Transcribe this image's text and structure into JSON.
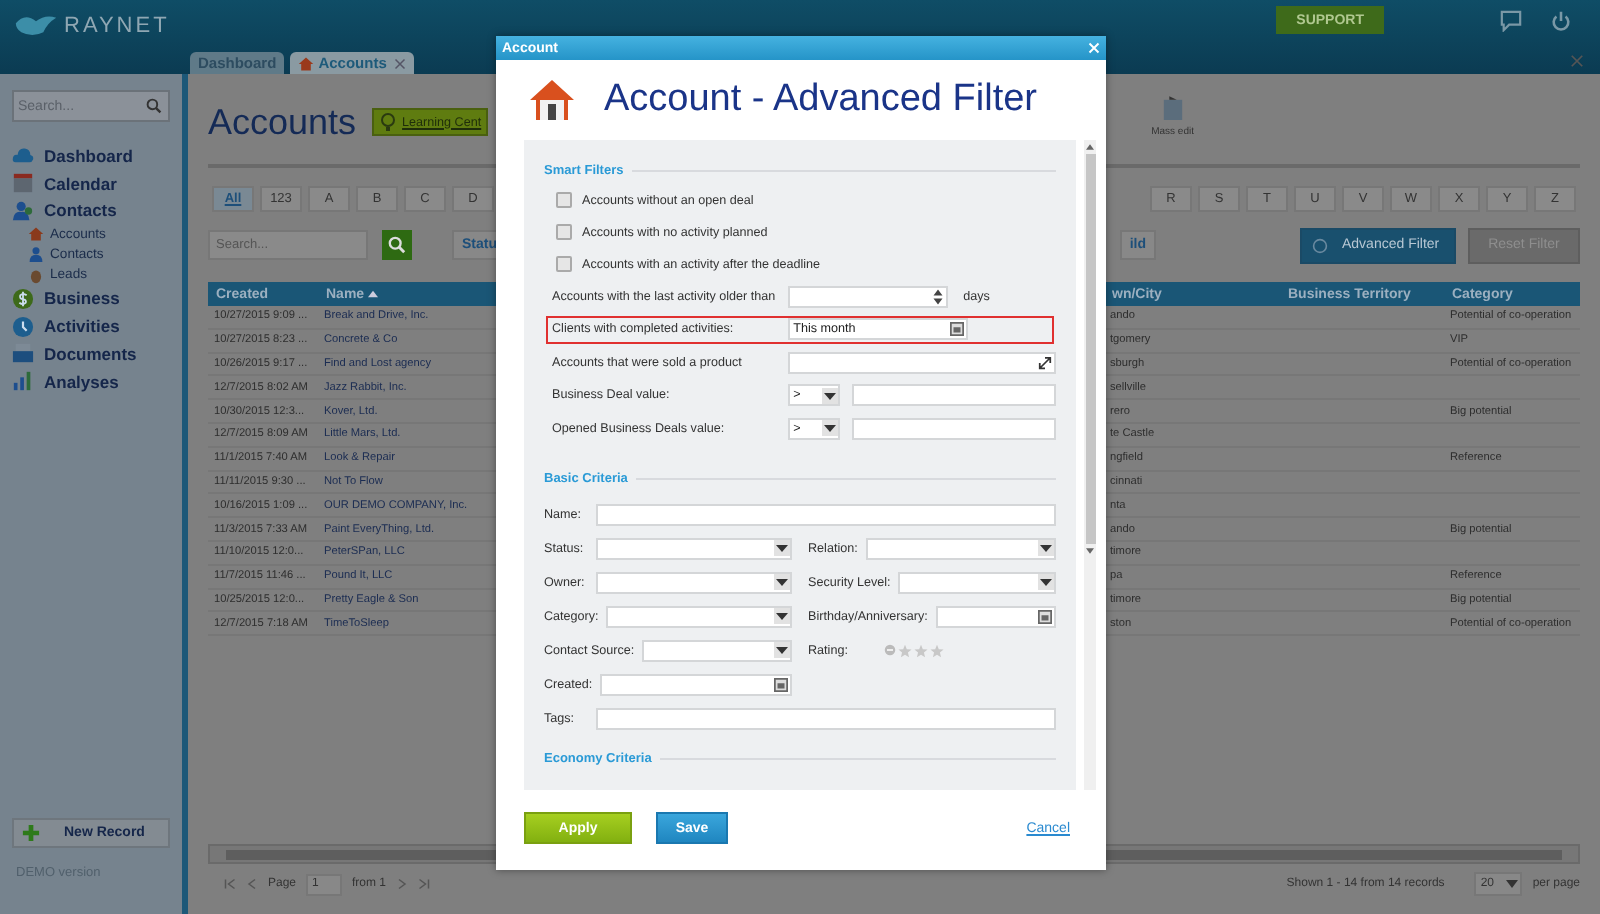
{
  "header": {
    "logo": "RAYNET",
    "support_button": "SUPPORT"
  },
  "tabs": [
    {
      "label": "Dashboard",
      "selected": false,
      "closable": false
    },
    {
      "label": "Accounts",
      "selected": true,
      "closable": true
    }
  ],
  "sidebar": {
    "search_placeholder": "Search...",
    "nav": [
      {
        "label": "Dashboard",
        "kind": "cloud"
      },
      {
        "label": "Calendar",
        "kind": "calendar"
      },
      {
        "label": "Contacts",
        "kind": "people",
        "children": [
          {
            "label": "Accounts",
            "kind": "house"
          },
          {
            "label": "Contacts",
            "kind": "person"
          },
          {
            "label": "Leads",
            "kind": "egg"
          }
        ]
      },
      {
        "label": "Business",
        "kind": "dollar"
      },
      {
        "label": "Activities",
        "kind": "clock"
      },
      {
        "label": "Documents",
        "kind": "tray"
      },
      {
        "label": "Analyses",
        "kind": "chart"
      }
    ],
    "new_record": "New Record",
    "footer": "DEMO version"
  },
  "main": {
    "title": "Accounts",
    "learning_center": "Learning Cent",
    "mass_edit": "Mass edit",
    "letters_left": [
      {
        "label": "All",
        "selected": true
      },
      {
        "label": "123",
        "selected": false
      },
      {
        "label": "A",
        "selected": false
      },
      {
        "label": "B",
        "selected": false
      },
      {
        "label": "C",
        "selected": false
      },
      {
        "label": "D",
        "selected": false
      }
    ],
    "letters_right": [
      {
        "label": "R",
        "selected": false
      },
      {
        "label": "S",
        "selected": false
      },
      {
        "label": "T",
        "selected": false
      },
      {
        "label": "U",
        "selected": false
      },
      {
        "label": "V",
        "selected": false
      },
      {
        "label": "W",
        "selected": false
      },
      {
        "label": "X",
        "selected": false
      },
      {
        "label": "Y",
        "selected": false
      },
      {
        "label": "Z",
        "selected": false
      }
    ],
    "search_placeholder": "Search...",
    "status_button": "Statu",
    "cut_button": "ild",
    "advanced_filter": "Advanced Filter",
    "reset_filter": "Reset Filter"
  },
  "table": {
    "columns": [
      "Created",
      "Name",
      "wn/City",
      "Business Territory",
      "Category"
    ],
    "rows": [
      {
        "created": "10/27/2015 9:09 ...",
        "name": "Break and Drive, Inc.",
        "town": "ando",
        "category": "Potential of co-operation"
      },
      {
        "created": "10/27/2015 8:23 ...",
        "name": "Concrete & Co",
        "town": "tgomery",
        "category": "VIP"
      },
      {
        "created": "10/26/2015 9:17 ...",
        "name": "Find and Lost agency",
        "town": "sburgh",
        "category": "Potential of co-operation"
      },
      {
        "created": "12/7/2015 8:02 AM",
        "name": "Jazz Rabbit, Inc.",
        "town": "sellville"
      },
      {
        "created": "10/30/2015 12:3...",
        "name": "Kover, Ltd.",
        "town": "rero",
        "category": "Big potential"
      },
      {
        "created": "12/7/2015 8:09 AM",
        "name": "Little Mars, Ltd.",
        "town": "te Castle"
      },
      {
        "created": "11/1/2015 7:40 AM",
        "name": "Look & Repair",
        "town": "ngfield",
        "category": "Reference"
      },
      {
        "created": "11/11/2015 9:30 ...",
        "name": "Not To Flow",
        "town": "cinnati"
      },
      {
        "created": "10/16/2015 1:09 ...",
        "name": "OUR DEMO COMPANY, Inc.",
        "town": "nta"
      },
      {
        "created": "11/3/2015 7:33 AM",
        "name": "Paint EveryThing, Ltd.",
        "town": "ando",
        "category": "Big potential"
      },
      {
        "created": "11/10/2015 12:0...",
        "name": "PeterSPan, LLC",
        "town": "timore"
      },
      {
        "created": "11/7/2015 11:46 ...",
        "name": "Pound It, LLC",
        "town": "pa",
        "category": "Reference"
      },
      {
        "created": "10/25/2015 12:0...",
        "name": "Pretty Eagle & Son",
        "town": "timore",
        "category": "Big potential"
      },
      {
        "created": "12/7/2015 7:18 AM",
        "name": "TimeToSleep",
        "town": "ston",
        "category": "Potential of co-operation"
      }
    ]
  },
  "pagination": {
    "page_label": "Page",
    "page": "1",
    "from": "from 1",
    "shown": "Shown 1 - 14 from 14 records",
    "per_page_value": "20",
    "per_page": "per page"
  },
  "modal": {
    "title": "Account",
    "heading": "Account - Advanced Filter",
    "smart_title": "Smart Filters",
    "checks": [
      {
        "label": "Accounts without an open deal",
        "checked": false
      },
      {
        "label": "Accounts with no activity planned",
        "checked": false
      },
      {
        "label": "Accounts with an activity after the deadline",
        "checked": false
      }
    ],
    "rows": [
      {
        "kind": "spinner",
        "label": "Accounts with the last activity older than",
        "suffix": "days",
        "highlighted": false
      },
      {
        "kind": "date",
        "label": "Clients with completed activities:",
        "value": "This month",
        "highlighted": true
      },
      {
        "kind": "picker",
        "label": "Accounts that were sold a product",
        "highlighted": false
      },
      {
        "kind": "compare",
        "label": "Business Deal value:",
        "operator": ">",
        "highlighted": false
      },
      {
        "kind": "compare",
        "label": "Opened Business Deals value:",
        "operator": ">",
        "highlighted": false
      }
    ],
    "basic_title": "Basic Criteria",
    "fields": [
      {
        "kind": "wide",
        "label": "Name:"
      },
      {
        "kind": "select",
        "label": "Status:"
      },
      {
        "kind": "select",
        "label": "Relation:"
      },
      {
        "kind": "select",
        "label": "Owner:"
      },
      {
        "kind": "select",
        "label": "Security Level:"
      },
      {
        "kind": "select",
        "label": "Category:"
      },
      {
        "kind": "date",
        "label": "Birthday/Anniversary:"
      },
      {
        "kind": "select",
        "label": "Contact Source:"
      },
      {
        "kind": "rating",
        "label": "Rating:",
        "stars": 0
      },
      {
        "kind": "date",
        "label": "Created:"
      },
      {
        "kind": "wide",
        "label": "Tags:"
      }
    ],
    "economy_title": "Economy Criteria",
    "apply": "Apply",
    "save": "Save",
    "cancel": "Cancel"
  }
}
